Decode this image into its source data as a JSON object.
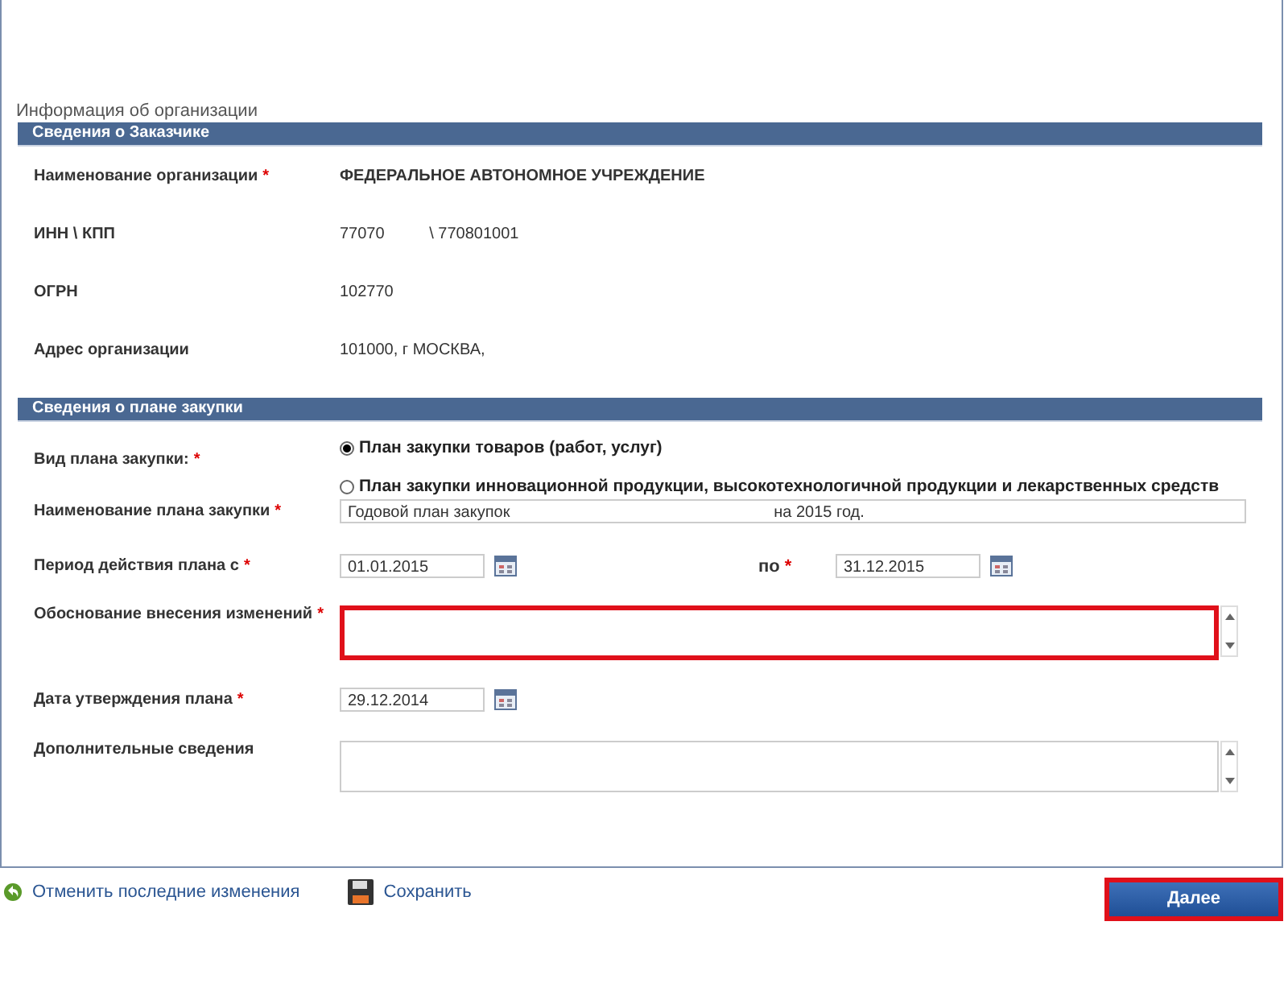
{
  "page_title": "Информация об организации",
  "customer": {
    "header": "Сведения о Заказчике",
    "rows": [
      {
        "label": "Наименование организации",
        "mark": "*",
        "value": "ФЕДЕРАЛЬНОЕ АВТОНОМНОЕ УЧРЕЖДЕНИЕ",
        "bold": true
      },
      {
        "label": "ИНН \\ КПП",
        "value": "77070          \\ 770801001",
        "bold": false
      },
      {
        "label": "ОГРН",
        "value": "102770",
        "bold": false
      },
      {
        "label": "Адрес организации",
        "value": "101000, г МОСКВА,",
        "bold": false
      }
    ]
  },
  "plan": {
    "header": "Сведения о плане закупки",
    "type": {
      "label": "Вид плана закупки:",
      "mark": "*",
      "options": [
        {
          "label": "План закупки товаров (работ, услуг)",
          "selected": true
        },
        {
          "label": "План закупки инновационной продукции, высокотехнологичной продукции и лекарственных средств",
          "selected": false
        }
      ]
    },
    "name": {
      "label": "Наименование плана закупки",
      "mark": "*",
      "value": "Годовой план закупок                                                           на 2015 год."
    },
    "period": {
      "label": "Период действия плана с",
      "mark": "*",
      "from": "01.01.2015",
      "to_label": "по",
      "to_mark": "*",
      "to": "31.12.2015"
    },
    "reason": {
      "label": "Обоснование внесения изменений",
      "mark": "*",
      "highlighted": true
    },
    "approval": {
      "label": "Дата утверждения плана",
      "mark": "*",
      "value": "29.12.2014"
    },
    "extra": {
      "label": "Дополнительные сведения",
      "highlighted": false
    }
  },
  "footer": {
    "undo": "Отменить последние изменения",
    "save": "Сохранить",
    "next": {
      "label": "Далее",
      "highlighted": true
    }
  }
}
